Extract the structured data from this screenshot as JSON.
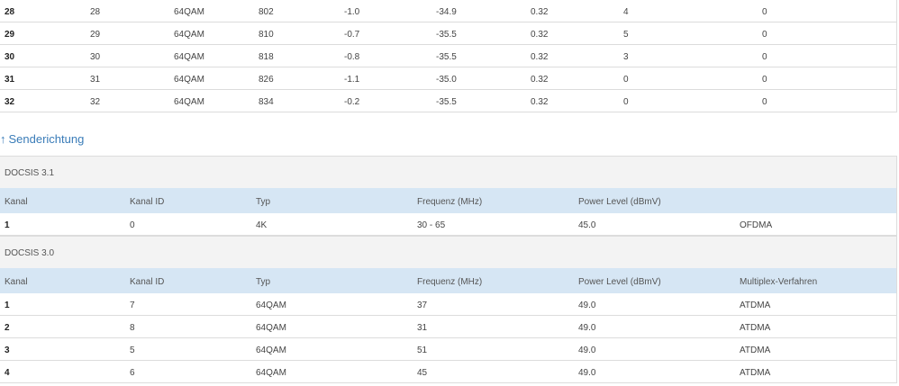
{
  "downstream": {
    "rows": [
      [
        "28",
        "28",
        "64QAM",
        "802",
        "-1.0",
        "-34.9",
        "0.32",
        "4",
        "0"
      ],
      [
        "29",
        "29",
        "64QAM",
        "810",
        "-0.7",
        "-35.5",
        "0.32",
        "5",
        "0"
      ],
      [
        "30",
        "30",
        "64QAM",
        "818",
        "-0.8",
        "-35.5",
        "0.32",
        "3",
        "0"
      ],
      [
        "31",
        "31",
        "64QAM",
        "826",
        "-1.1",
        "-35.0",
        "0.32",
        "0",
        "0"
      ],
      [
        "32",
        "32",
        "64QAM",
        "834",
        "-0.2",
        "-35.5",
        "0.32",
        "0",
        "0"
      ]
    ]
  },
  "upstream": {
    "arrow": "↑",
    "title": "Senderichtung",
    "docsis31": {
      "label": "DOCSIS 3.1",
      "headers": [
        "Kanal",
        "Kanal ID",
        "Typ",
        "Frequenz (MHz)",
        "Power Level (dBmV)",
        ""
      ],
      "rows": [
        [
          "1",
          "0",
          "4K",
          "30 - 65",
          "45.0",
          "OFDMA"
        ]
      ]
    },
    "docsis30": {
      "label": "DOCSIS 3.0",
      "headers": [
        "Kanal",
        "Kanal ID",
        "Typ",
        "Frequenz (MHz)",
        "Power Level (dBmV)",
        "Multiplex-Verfahren"
      ],
      "rows": [
        [
          "1",
          "7",
          "64QAM",
          "37",
          "49.0",
          "ATDMA"
        ],
        [
          "2",
          "8",
          "64QAM",
          "31",
          "49.0",
          "ATDMA"
        ],
        [
          "3",
          "5",
          "64QAM",
          "51",
          "49.0",
          "ATDMA"
        ],
        [
          "4",
          "6",
          "64QAM",
          "45",
          "49.0",
          "ATDMA"
        ]
      ]
    }
  }
}
